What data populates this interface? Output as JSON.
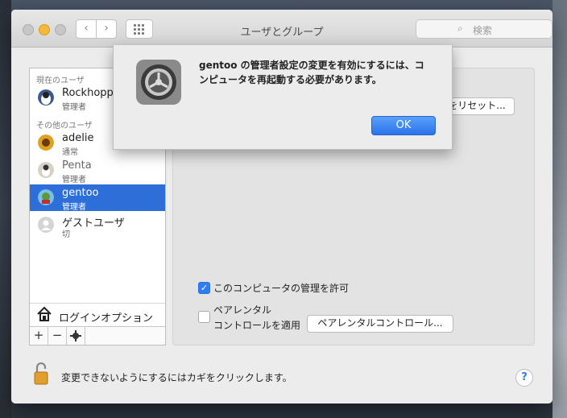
{
  "window": {
    "title": "ユーザとグループ",
    "search_placeholder": "検索"
  },
  "sidebar": {
    "current_users_label": "現在のユーザ",
    "other_users_label": "その他のユーザ",
    "users": [
      {
        "name": "Rockhopper",
        "role": "管理者"
      },
      {
        "name": "adelie",
        "role": "通常"
      },
      {
        "name": "Penta",
        "role": "管理者"
      },
      {
        "name": "gentoo",
        "role": "管理者",
        "selected": true
      },
      {
        "name": "ゲストユーザ",
        "role": "切"
      }
    ],
    "login_options_label": "ログインオプション",
    "toolbar": {
      "add": "+",
      "remove": "−"
    }
  },
  "panel": {
    "reset_button": "をリセット...",
    "allow_admin_label": "このコンピュータの管理を許可",
    "allow_admin_checked": true,
    "parental_label_line1": "ペアレンタル",
    "parental_label_line2": "コントロールを適用",
    "parental_checked": false,
    "parental_button": "ペアレンタルコントロール..."
  },
  "footer": {
    "lock_text": "変更できないようにするにはカギをクリックします。",
    "help": "?"
  },
  "sheet": {
    "message": "gentoo の管理者設定の変更を有効にするには、コンピュータを再起動する必要があります。",
    "ok_button": "OK"
  }
}
